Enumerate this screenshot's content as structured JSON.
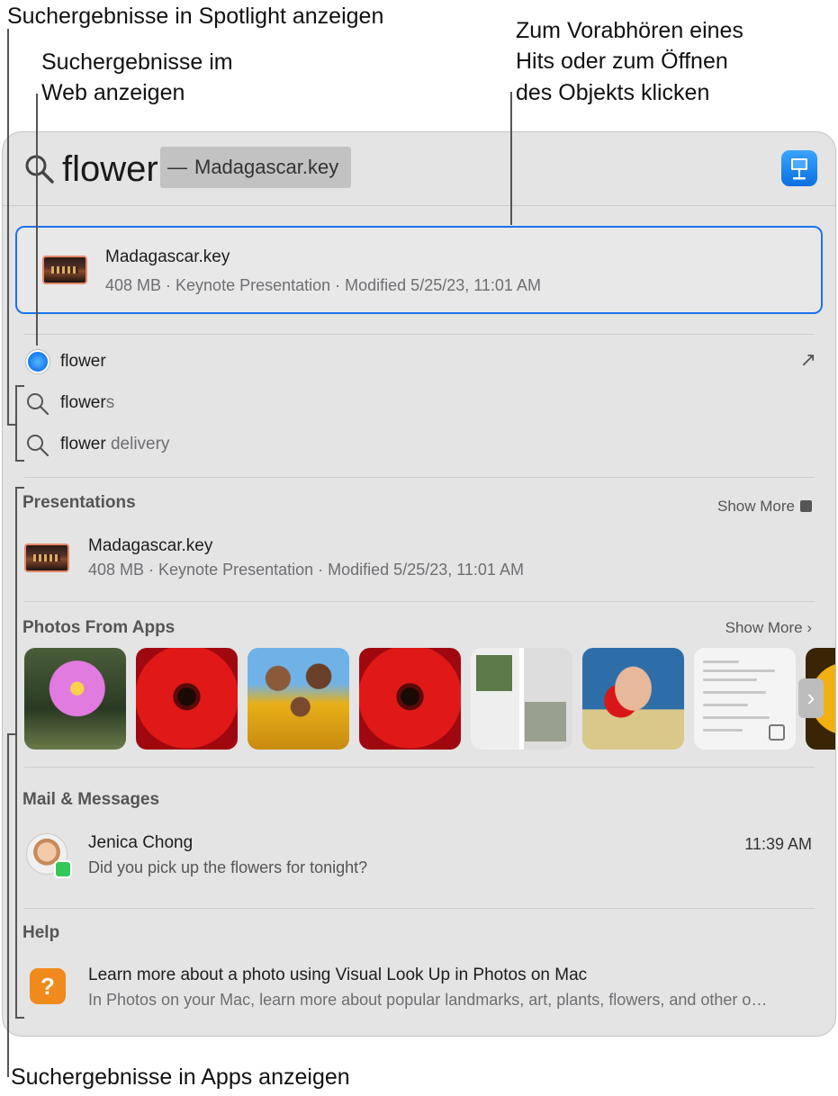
{
  "callouts": {
    "spotlight": "Suchergebnisse in Spotlight anzeigen",
    "web_line1": "Suchergebnisse im",
    "web_line2": "Web anzeigen",
    "preview_line1": "Zum Vorabhören eines",
    "preview_line2": "Hits oder zum Öffnen",
    "preview_line3": "des Objekts klicken",
    "apps": "Suchergebnisse in Apps anzeigen"
  },
  "search": {
    "query": "flower",
    "completion_dash": "—",
    "completion": "Madagascar.key"
  },
  "top_hit": {
    "title": "Madagascar.key",
    "subtitle": "408 MB · Keynote Presentation · Modified 5/25/23, 11:01 AM"
  },
  "suggestions": [
    {
      "bold": "flower",
      "rest": ""
    },
    {
      "bold": "flower",
      "rest": "s"
    },
    {
      "bold": "flower",
      "rest": " delivery"
    }
  ],
  "presentations": {
    "title": "Presentations",
    "show_more": "Show More",
    "item_title": "Madagascar.key",
    "item_subtitle": "408 MB · Keynote Presentation · Modified 5/25/23, 11:01 AM"
  },
  "photos": {
    "title": "Photos From Apps",
    "show_more": "Show More ›"
  },
  "mail": {
    "title": "Mail & Messages",
    "sender": "Jenica Chong",
    "time": "11:39 AM",
    "preview": "Did you pick up the flowers for tonight?"
  },
  "help": {
    "title": "Help",
    "item_title": "Learn more about a photo using Visual Look Up in Photos on Mac",
    "item_subtitle": "In Photos on your Mac, learn more about popular landmarks, art, plants, flowers, and other o…",
    "icon_glyph": "?"
  },
  "icons": {
    "web_arrow": "↗",
    "next_chevron": "›"
  },
  "colors": {
    "accent": "#1a73e8",
    "panel": "#e4e4e4"
  }
}
